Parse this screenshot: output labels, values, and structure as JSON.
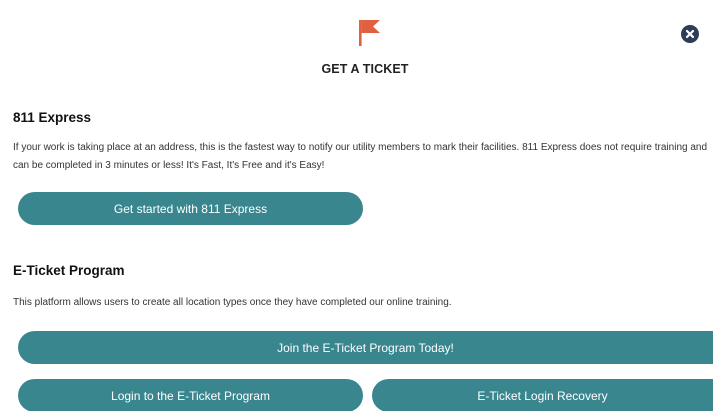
{
  "modal": {
    "title": "GET A TICKET",
    "header_icon": "flag-icon",
    "close_icon": "close-icon",
    "accent_color": "#39868f",
    "flag_color": "#e0603f"
  },
  "express": {
    "heading": "811 Express",
    "description": "If your work is taking place at an address, this is the fastest way to notify our utility members to mark their facilities. 811 Express does not require training and can be completed in 3 minutes or less! It's Fast, It's Free and it's Easy!",
    "button_label": "Get started with 811 Express"
  },
  "eticket": {
    "heading": "E-Ticket Program",
    "description": "This platform allows users to create all location types once they have completed our online training.",
    "join_label": "Join the E-Ticket Program Today!",
    "login_label": "Login to the E-Ticket Program",
    "recovery_label": "E-Ticket Login Recovery"
  }
}
